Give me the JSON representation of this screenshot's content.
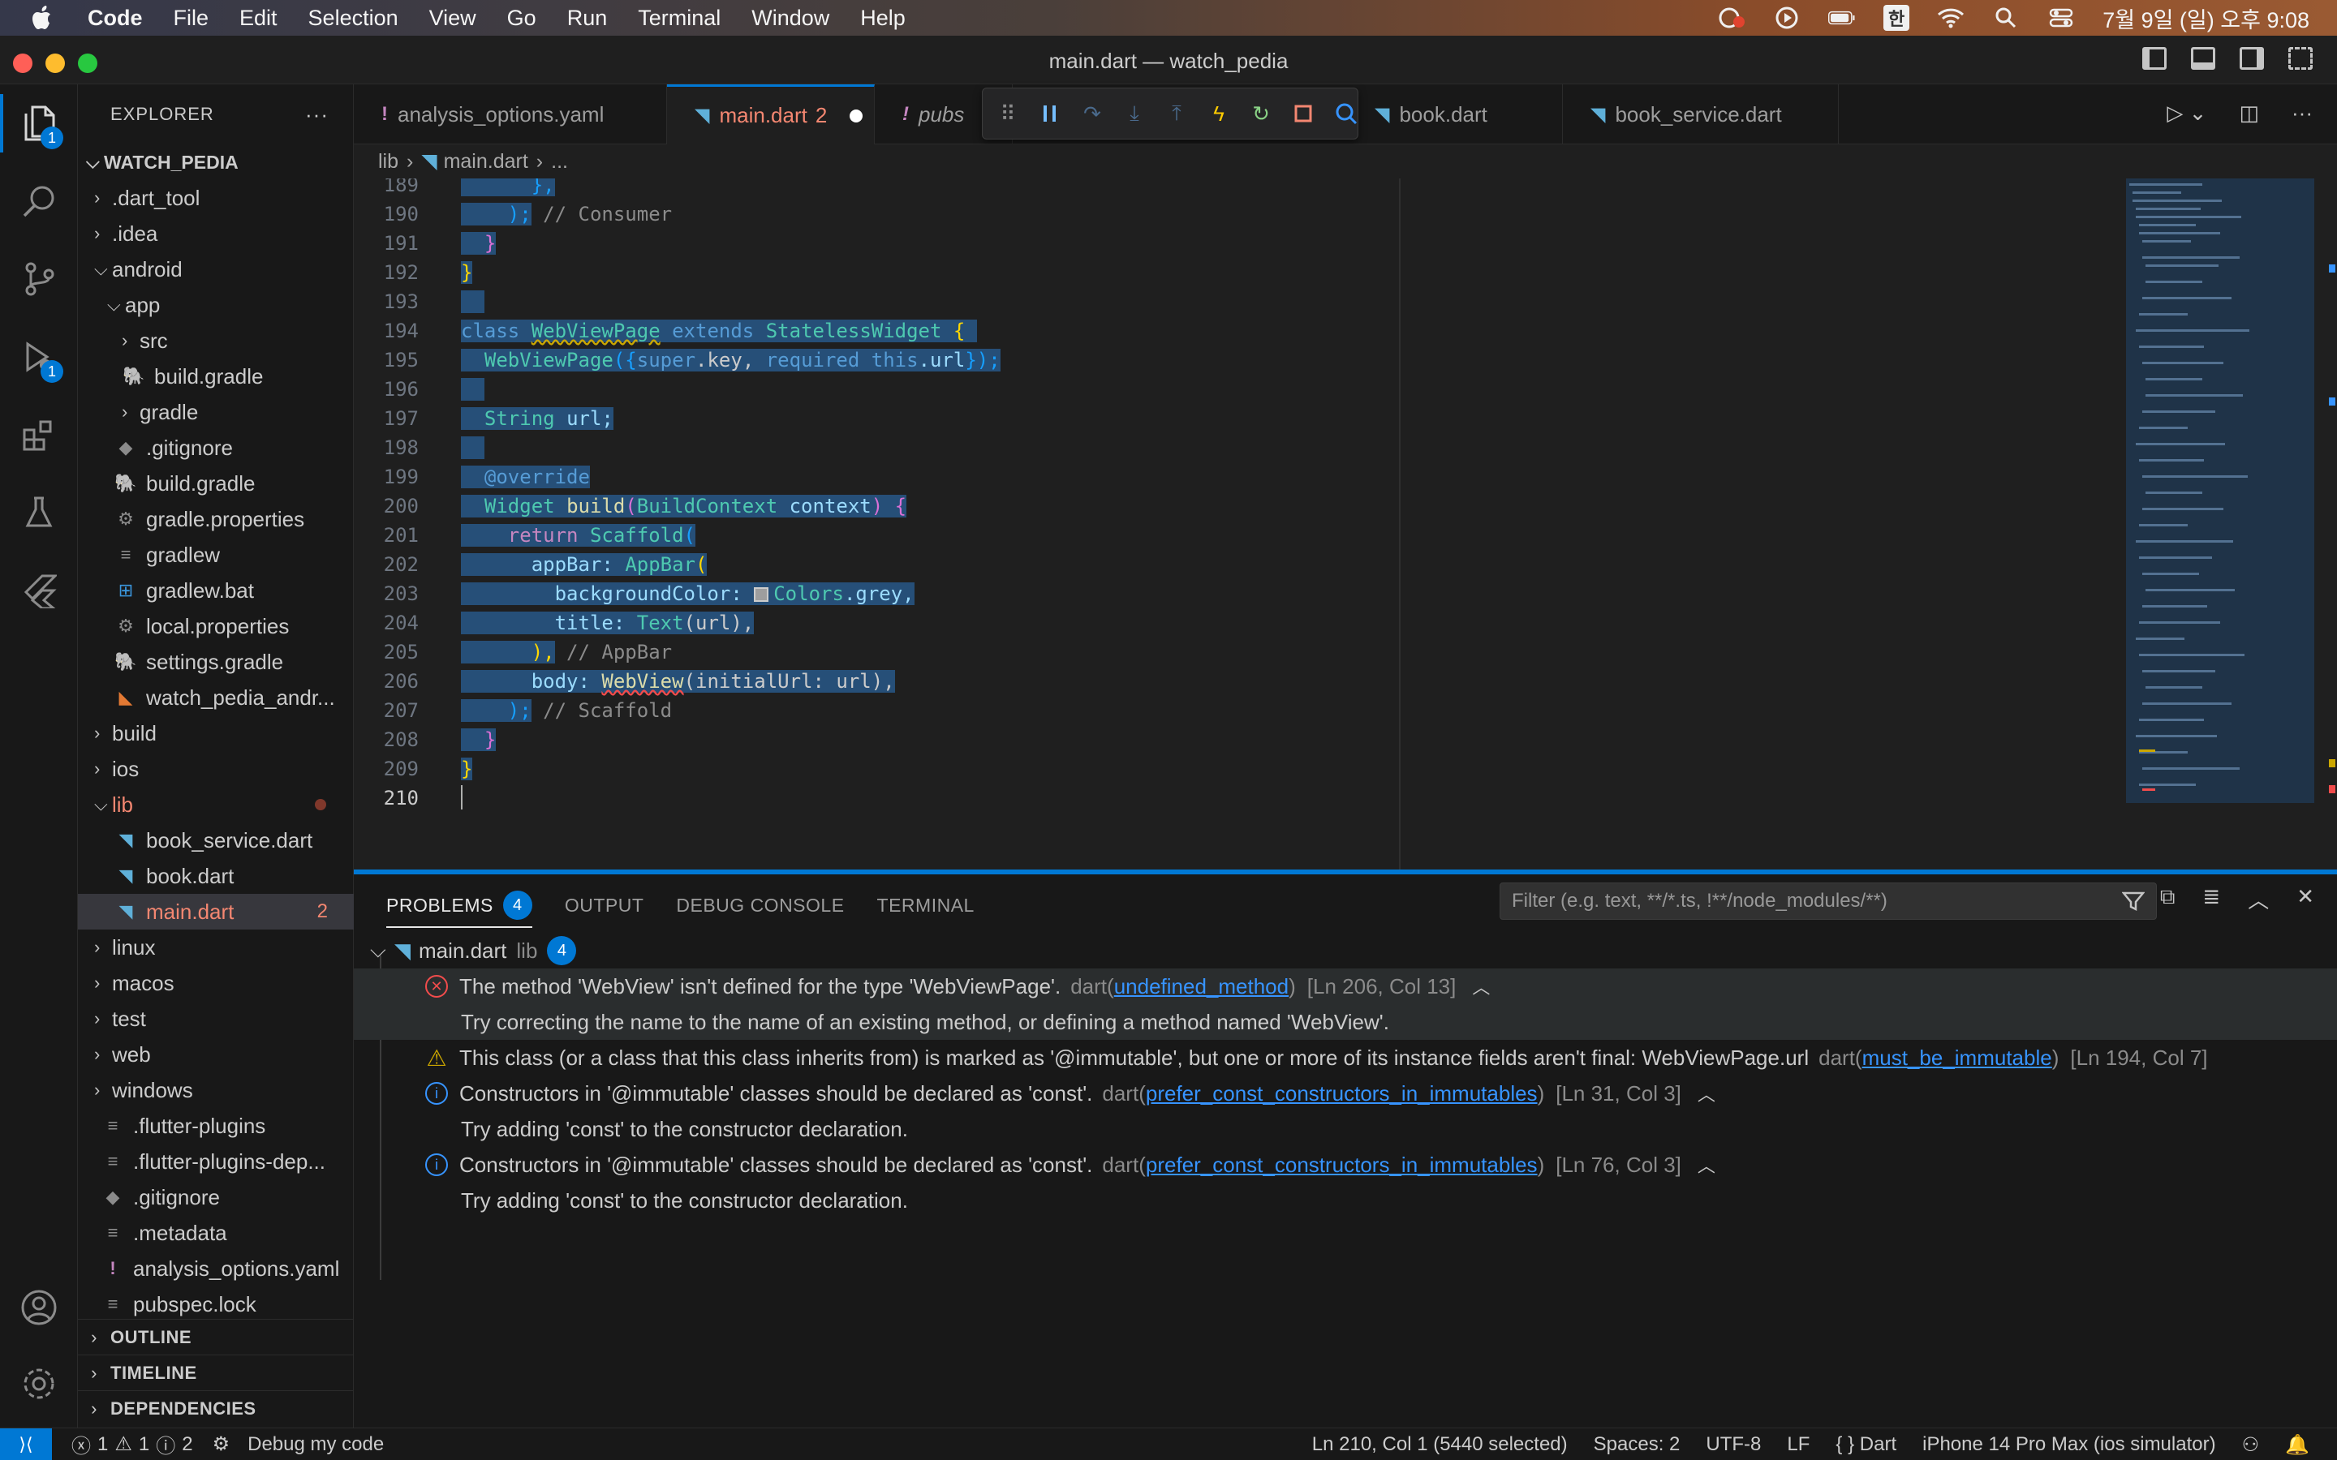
{
  "menubar": {
    "app": "Code",
    "items": [
      "File",
      "Edit",
      "Selection",
      "View",
      "Go",
      "Run",
      "Terminal",
      "Window",
      "Help"
    ],
    "input_method": "한",
    "datetime": "7월 9일 (일) 오후 9:08"
  },
  "window": {
    "title": "main.dart — watch_pedia"
  },
  "activity": {
    "explorer_badge": "1",
    "debug_badge": "1"
  },
  "explorer": {
    "header": "EXPLORER",
    "root": "WATCH_PEDIA",
    "items": [
      {
        "label": ".dart_tool"
      },
      {
        "label": ".idea"
      },
      {
        "label": "android"
      },
      {
        "label": "app"
      },
      {
        "label": "src"
      },
      {
        "label": "build.gradle"
      },
      {
        "label": "gradle"
      },
      {
        "label": ".gitignore"
      },
      {
        "label": "build.gradle"
      },
      {
        "label": "gradle.properties"
      },
      {
        "label": "gradlew"
      },
      {
        "label": "gradlew.bat"
      },
      {
        "label": "local.properties"
      },
      {
        "label": "settings.gradle"
      },
      {
        "label": "watch_pedia_andr..."
      },
      {
        "label": "build"
      },
      {
        "label": "ios"
      },
      {
        "label": "lib"
      },
      {
        "label": "book_service.dart"
      },
      {
        "label": "book.dart"
      },
      {
        "label": "main.dart",
        "count": "2"
      },
      {
        "label": "linux"
      },
      {
        "label": "macos"
      },
      {
        "label": "test"
      },
      {
        "label": "web"
      },
      {
        "label": "windows"
      },
      {
        "label": ".flutter-plugins"
      },
      {
        "label": ".flutter-plugins-dep..."
      },
      {
        "label": ".gitignore"
      },
      {
        "label": ".metadata"
      },
      {
        "label": "analysis_options.yaml"
      },
      {
        "label": "pubspec.lock"
      }
    ],
    "sections": [
      "OUTLINE",
      "TIMELINE",
      "DEPENDENCIES"
    ]
  },
  "tabs": [
    {
      "label": "analysis_options.yaml",
      "icon": "!"
    },
    {
      "label": "main.dart",
      "count": "2"
    },
    {
      "label": "pubs",
      "icon": "!"
    },
    {
      "label": "book.dart"
    },
    {
      "label": "book_service.dart"
    }
  ],
  "breadcrumb": [
    "lib",
    "main.dart",
    "..."
  ],
  "editor": {
    "line_numbers": [
      "189",
      "190",
      "191",
      "192",
      "193",
      "194",
      "195",
      "196",
      "197",
      "198",
      "199",
      "200",
      "201",
      "202",
      "203",
      "204",
      "205",
      "206",
      "207",
      "208",
      "209",
      "210"
    ],
    "lines": {
      "l189": "      },",
      "l190a": "    );",
      "l190b": " // Consumer",
      "l191": "  }",
      "l192": "}",
      "l194_class": "class",
      "l194_name": "WebViewPage",
      "l194_ext": "extends",
      "l194_base": "StatelessWidget",
      "l194_brace": "{",
      "l195_ctor": "WebViewPage",
      "l195_args_a": "({",
      "l195_super": "super",
      "l195_key": ".key, ",
      "l195_req": "required",
      "l195_this": "this",
      "l195_url": ".url",
      "l195_end": "});",
      "l197_type": "String",
      "l197_var": "url;",
      "l199": "@override",
      "l200_type": "Widget",
      "l200_fn": "build",
      "l200_p": "(",
      "l200_ctx_t": "BuildContext",
      "l200_ctx": "context",
      "l200_end": ") {",
      "l201_ret": "return",
      "l201_w": "Scaffold",
      "l201_p": "(",
      "l202_k": "appBar:",
      "l202_w": "AppBar",
      "l202_p": "(",
      "l203_k": "backgroundColor:",
      "l203_c": "Colors",
      "l203_v": ".grey,",
      "l204_k": "title:",
      "l204_w": "Text",
      "l204_a": "(url),",
      "l205a": "),",
      "l205b": " // AppBar",
      "l206_k": "body:",
      "l206_w": "WebView",
      "l206_a": "(initialUrl: url),",
      "l207a": ");",
      "l207b": " // Scaffold",
      "l208": "}",
      "l209": "}"
    }
  },
  "panel": {
    "tabs": [
      "PROBLEMS",
      "OUTPUT",
      "DEBUG CONSOLE",
      "TERMINAL"
    ],
    "problems_count": "4",
    "filter_placeholder": "Filter (e.g. text, **/*.ts, !**/node_modules/**)",
    "file": {
      "name": "main.dart",
      "folder": "lib",
      "count": "4"
    },
    "problems": [
      {
        "severity": "error",
        "message": "The method 'WebView' isn't defined for the type 'WebViewPage'.",
        "source": "dart",
        "code": "undefined_method",
        "position": "[Ln 206, Col 13]",
        "hint": "Try correcting the name to the name of an existing method, or defining a method named 'WebView'."
      },
      {
        "severity": "warning",
        "message": "This class (or a class that this class inherits from) is marked as '@immutable', but one or more of its instance fields aren't final: WebViewPage.url",
        "source": "dart",
        "code": "must_be_immutable",
        "position": "[Ln 194, Col 7]"
      },
      {
        "severity": "info",
        "message": "Constructors in '@immutable' classes should be declared as 'const'.",
        "source": "dart",
        "code": "prefer_const_constructors_in_immutables",
        "position": "[Ln 31, Col 3]",
        "hint": "Try adding 'const' to the constructor declaration."
      },
      {
        "severity": "info",
        "message": "Constructors in '@immutable' classes should be declared as 'const'.",
        "source": "dart",
        "code": "prefer_const_constructors_in_immutables",
        "position": "[Ln 76, Col 3]",
        "hint": "Try adding 'const' to the constructor declaration."
      }
    ]
  },
  "status": {
    "errors": "1",
    "warnings": "1",
    "infos": "2",
    "debug": "Debug my code",
    "cursor": "Ln 210, Col 1 (5440 selected)",
    "spaces": "Spaces: 2",
    "encoding": "UTF-8",
    "eol": "LF",
    "language": "Dart",
    "device": "iPhone 14 Pro Max (ios simulator)"
  },
  "colors": {
    "accent": "#0078d4",
    "error": "#f14c4c",
    "warning": "#cca700",
    "info": "#3794ff",
    "selection": "#264f78"
  }
}
